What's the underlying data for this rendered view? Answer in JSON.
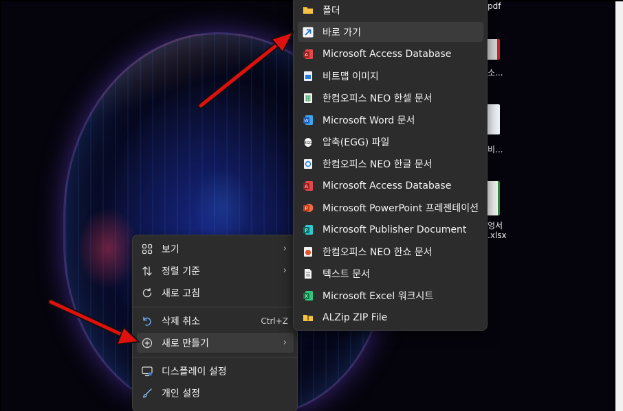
{
  "desktop": {
    "icon_labels": [
      "pdf",
      "소...",
      "비...",
      "엉서",
      ".xlsx"
    ]
  },
  "context_menu": {
    "items": [
      {
        "label": "보기",
        "icon": "grid-view-icon",
        "has_submenu": true
      },
      {
        "label": "정렬 기준",
        "icon": "sort-arrows-icon",
        "has_submenu": true
      },
      {
        "label": "새로 고침",
        "icon": "refresh-icon",
        "has_submenu": false
      },
      {
        "label": "삭제 취소",
        "icon": "undo-icon",
        "shortcut": "Ctrl+Z"
      },
      {
        "label": "새로 만들기",
        "icon": "new-plus-icon",
        "has_submenu": true,
        "highlighted": true
      },
      {
        "label": "디스플레이 설정",
        "icon": "display-settings-icon"
      },
      {
        "label": "개인 설정",
        "icon": "personalize-brush-icon"
      }
    ]
  },
  "new_submenu": {
    "items": [
      {
        "label": "폴더",
        "icon": "folder-icon"
      },
      {
        "label": "바로 가기",
        "icon": "shortcut-arrow-icon",
        "highlighted": true
      },
      {
        "label": "Microsoft Access Database",
        "icon": "access-icon"
      },
      {
        "label": "비트맵 이미지",
        "icon": "bitmap-icon"
      },
      {
        "label": "한컴오피스 NEO 한셀 문서",
        "icon": "hancell-icon"
      },
      {
        "label": "Microsoft Word 문서",
        "icon": "word-icon"
      },
      {
        "label": "압축(EGG) 파일",
        "icon": "egg-archive-icon"
      },
      {
        "label": "한컴오피스 NEO 한글 문서",
        "icon": "hwp-icon"
      },
      {
        "label": "Microsoft Access Database",
        "icon": "access-icon"
      },
      {
        "label": "Microsoft PowerPoint 프레젠테이션",
        "icon": "powerpoint-icon"
      },
      {
        "label": "Microsoft Publisher Document",
        "icon": "publisher-icon"
      },
      {
        "label": "한컴오피스 NEO 한쇼 문서",
        "icon": "hanshow-icon"
      },
      {
        "label": "텍스트 문서",
        "icon": "text-document-icon"
      },
      {
        "label": "Microsoft Excel 워크시트",
        "icon": "excel-icon"
      },
      {
        "label": "ALZip ZIP File",
        "icon": "zip-folder-icon"
      }
    ]
  },
  "colors": {
    "menu_bg": "#2c2c2c",
    "menu_highlight": "#3b3b3b",
    "arrow_red": "#e01010"
  }
}
